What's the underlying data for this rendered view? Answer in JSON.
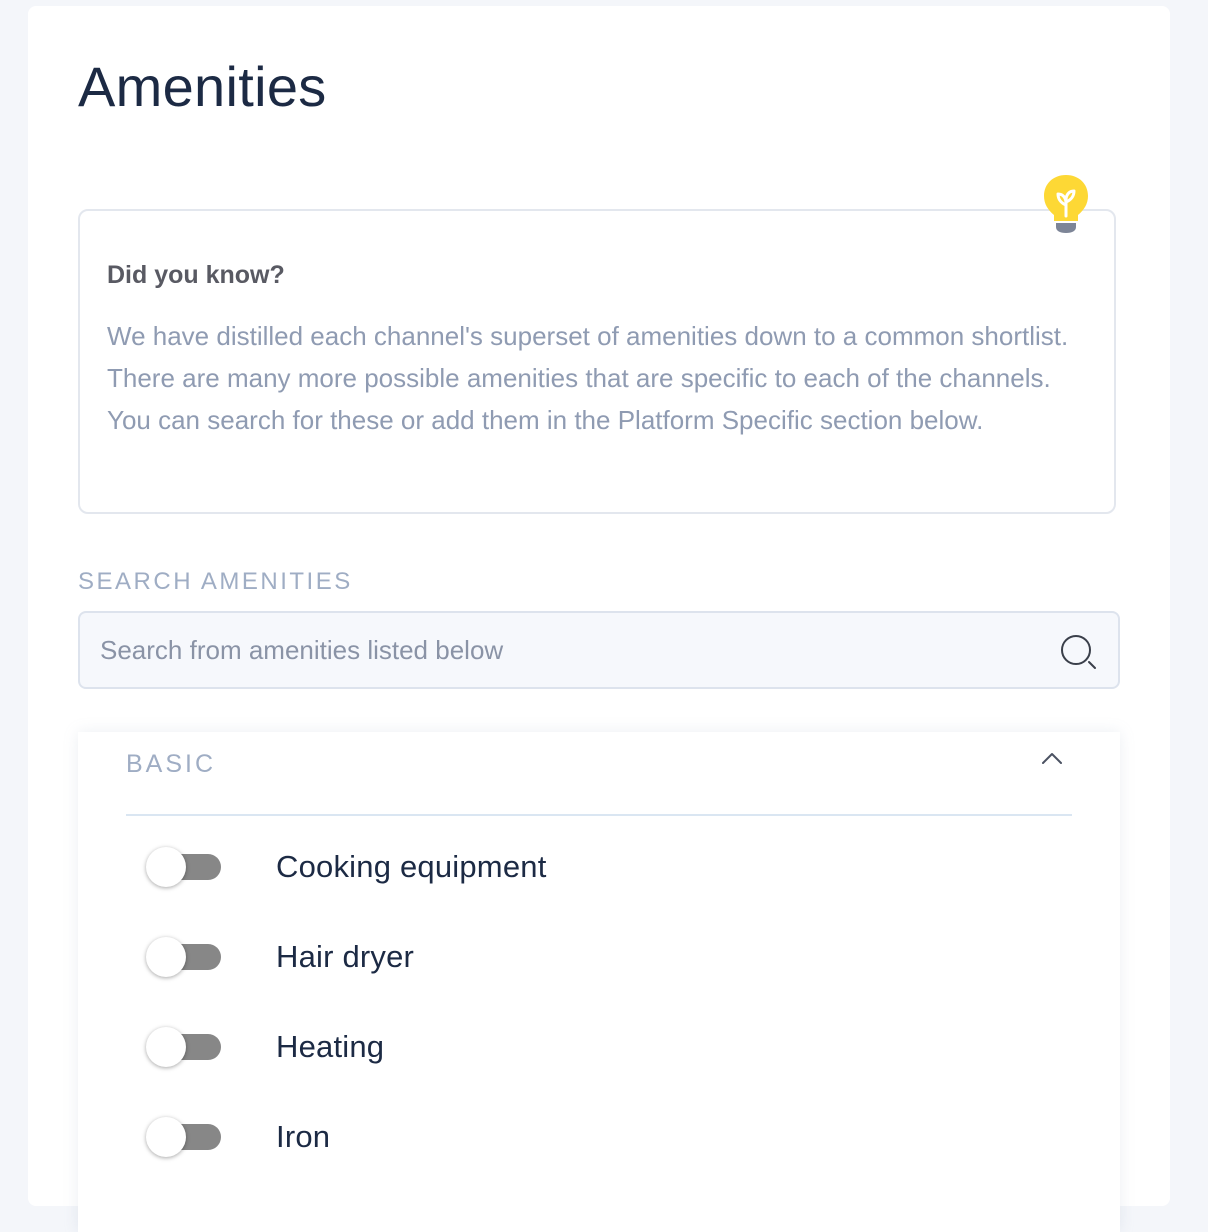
{
  "page": {
    "title": "Amenities"
  },
  "tip": {
    "heading": "Did you know?",
    "body": "We have distilled each channel's superset of amenities down to a common shortlist. There are many more possible amenities that are specific to each of the channels. You can search for these or add them in the Platform Specific section below.",
    "icon": "lightbulb-icon",
    "icon_color": "#fdd835"
  },
  "search": {
    "label": "SEARCH AMENITIES",
    "placeholder": "Search from amenities listed below",
    "value": "",
    "icon": "search-icon"
  },
  "section": {
    "title": "BASIC",
    "expanded": true,
    "icon": "chevron-up-icon",
    "items": [
      {
        "label": "Cooking equipment",
        "enabled": false
      },
      {
        "label": "Hair dryer",
        "enabled": false
      },
      {
        "label": "Heating",
        "enabled": false
      },
      {
        "label": "Iron",
        "enabled": false
      }
    ]
  },
  "colors": {
    "background": "#f4f6fa",
    "title_text": "#1c2a44",
    "muted_text": "#8f9bb2",
    "label_text": "#9fadc4",
    "toggle_off_track": "#878787",
    "bulb_yellow": "#fdd835"
  }
}
